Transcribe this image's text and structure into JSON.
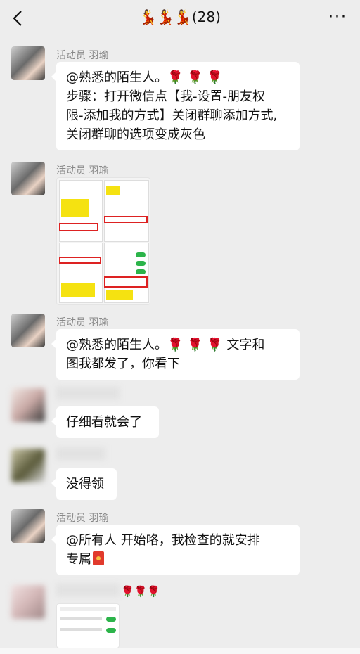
{
  "header": {
    "title": "💃💃💃(28)",
    "back_icon": "chevron-left-icon",
    "more_icon": "ellipsis-icon",
    "more_label": "···"
  },
  "messages": [
    {
      "sender": "活动员 羽瑜",
      "text_lines": [
        "@熟悉的陌生人。🌹 🌹 🌹",
        "步骤：打开微信点【我-设置-朋友权",
        "限-添加我的方式】关闭群聊添加方式,",
        "关闭群聊的选项变成灰色"
      ]
    },
    {
      "sender": "活动员 羽瑜",
      "image": "screenshot-instructions-image"
    },
    {
      "sender": "活动员 羽瑜",
      "text_lines": [
        "@熟悉的陌生人。🌹 🌹 🌹  文字和",
        "图我都发了，你看下"
      ]
    },
    {
      "sender": "",
      "text_lines": [
        "仔细看就会了"
      ]
    },
    {
      "sender": "",
      "text_lines": [
        "没得领"
      ]
    },
    {
      "sender": "活动员 羽瑜",
      "text_lines": [
        "@所有人  开始咯，我检查的就安排",
        "专属"
      ],
      "redpacket_icon": "red-packet-icon"
    },
    {
      "sender": "",
      "roses": "🌹🌹🌹",
      "image": "settings-screenshot-image"
    }
  ],
  "colors": {
    "background": "#ededed",
    "bubble": "#ffffff",
    "rose": "#c01010"
  }
}
